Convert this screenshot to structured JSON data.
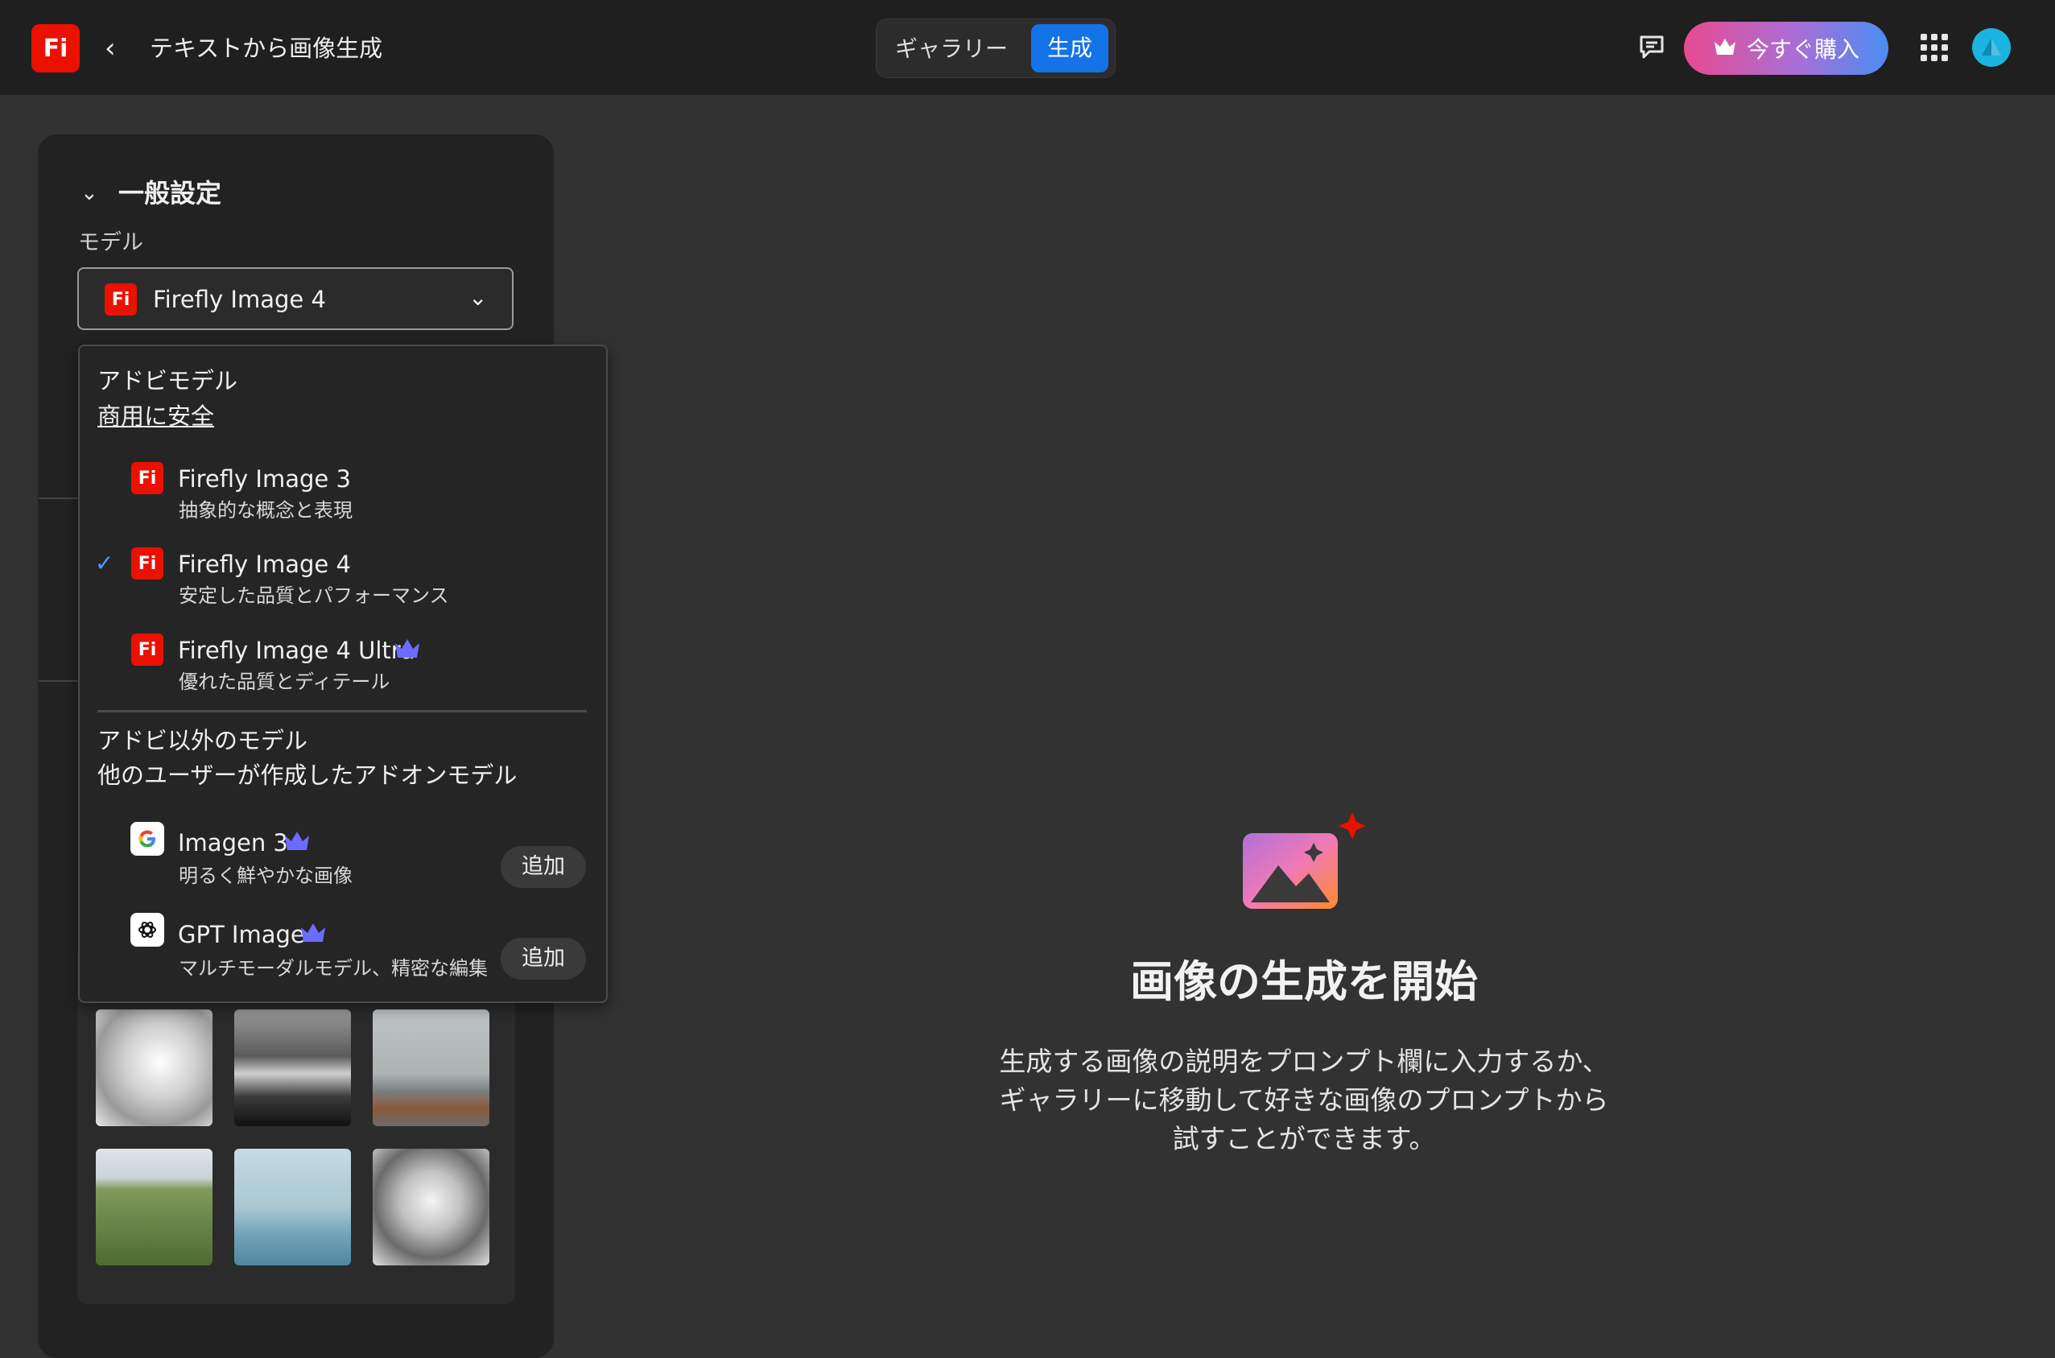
{
  "header": {
    "logo_text": "Fi",
    "title": "テキストから画像生成",
    "tabs": [
      {
        "label": "ギャラリー",
        "active": false
      },
      {
        "label": "生成",
        "active": true
      }
    ],
    "buy_label": "今すぐ購入",
    "icons": [
      "chevron-left-icon",
      "chat-icon",
      "crown-icon",
      "apps-grid-icon"
    ]
  },
  "panel": {
    "section_title": "一般設定",
    "model_label": "モデル",
    "selected_model": "Firefly Image 4"
  },
  "dropdown": {
    "adobe_heading": "アドビモデル",
    "adobe_sub": "商用に安全",
    "adobe_models": [
      {
        "name": "Firefly Image 3",
        "desc": "抽象的な概念と表現",
        "selected": false,
        "premium": false
      },
      {
        "name": "Firefly Image 4",
        "desc": "安定した品質とパフォーマンス",
        "selected": true,
        "premium": false
      },
      {
        "name": "Firefly Image 4 Ultra",
        "desc": "優れた品質とディテール",
        "selected": false,
        "premium": true
      }
    ],
    "partner_heading": "アドビ以外のモデル",
    "partner_sub": "他のユーザーが作成したアドオンモデル",
    "partner_models": [
      {
        "name": "Imagen 3",
        "desc": "明るく鮮やかな画像",
        "icon": "google-icon",
        "add_label": "追加",
        "premium": true
      },
      {
        "name": "GPT Image",
        "desc": "マルチモーダルモデル、精密な編集",
        "icon": "openai-icon",
        "add_label": "追加",
        "premium": true
      }
    ]
  },
  "empty_state": {
    "title": "画像の生成を開始",
    "lines": [
      "生成する画像の説明をプロンプト欄に入力するか、",
      "ギャラリーに移動して好きな画像のプロンプトから",
      "試すことができます。"
    ]
  },
  "colors": {
    "accent_blue": "#1473e6",
    "firefly_red": "#eb1000",
    "premium_crown": "#6b6bff"
  }
}
